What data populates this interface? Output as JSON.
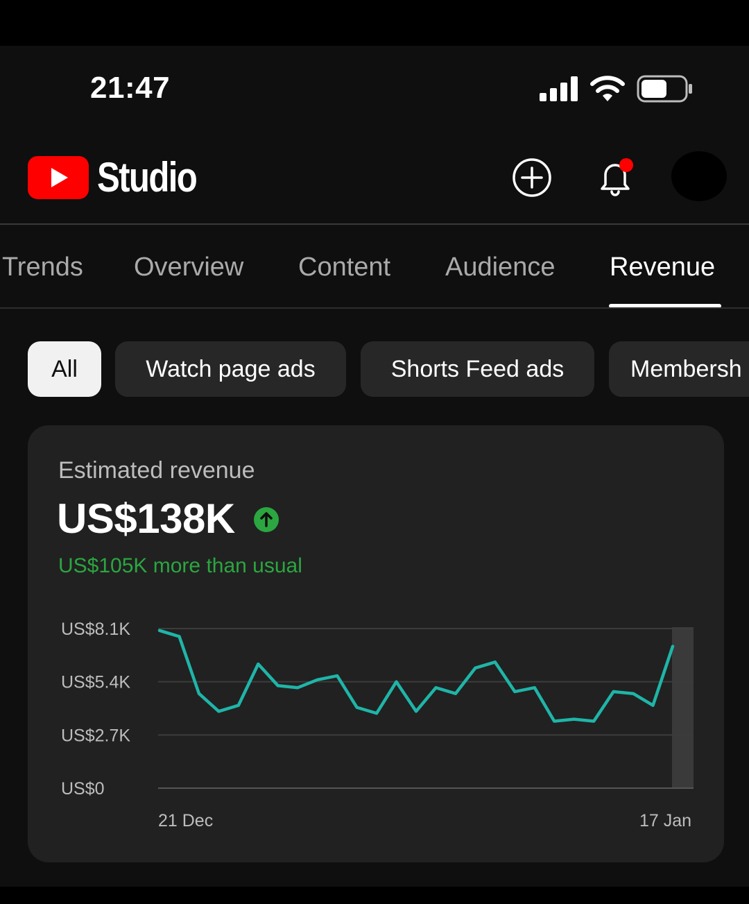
{
  "status_bar": {
    "time": "21:47",
    "icons": [
      "cellular-signal-icon",
      "wifi-icon",
      "battery-icon"
    ]
  },
  "header": {
    "brand": "Studio",
    "logo_icon": "youtube-play-icon",
    "actions": [
      "create-plus-icon",
      "notification-bell-icon",
      "account-avatar"
    ],
    "notification_dot_color": "#ff0000"
  },
  "tabs": [
    {
      "label": "Trends",
      "active": false
    },
    {
      "label": "Overview",
      "active": false
    },
    {
      "label": "Content",
      "active": false
    },
    {
      "label": "Audience",
      "active": false
    },
    {
      "label": "Revenue",
      "active": true
    }
  ],
  "chips": [
    {
      "label": "All",
      "selected": true
    },
    {
      "label": "Watch page ads",
      "selected": false
    },
    {
      "label": "Shorts Feed ads",
      "selected": false
    },
    {
      "label": "Membersh",
      "selected": false
    }
  ],
  "revenue_card": {
    "label": "Estimated revenue",
    "value": "US$138K",
    "trend_icon": "arrow-up-circle-icon",
    "delta": "US$105K more than usual"
  },
  "colors": {
    "background": "#0f0f0f",
    "card": "#212121",
    "accent_line": "#1fb5a8",
    "positive": "#2ba640",
    "youtube_red": "#ff0000"
  },
  "chart_data": {
    "type": "line",
    "title": "",
    "y_ticks": [
      "US$8.1K",
      "US$5.4K",
      "US$2.7K",
      "US$0"
    ],
    "y_tick_values": [
      8100,
      5400,
      2700,
      0
    ],
    "ylim": [
      0,
      8100
    ],
    "x_tick_labels": [
      "21 Dec",
      "17 Jan"
    ],
    "x": [
      "21 Dec",
      "22 Dec",
      "23 Dec",
      "24 Dec",
      "25 Dec",
      "26 Dec",
      "27 Dec",
      "28 Dec",
      "29 Dec",
      "30 Dec",
      "31 Dec",
      "1 Jan",
      "2 Jan",
      "3 Jan",
      "4 Jan",
      "5 Jan",
      "6 Jan",
      "7 Jan",
      "8 Jan",
      "9 Jan",
      "10 Jan",
      "11 Jan",
      "12 Jan",
      "13 Jan",
      "14 Jan",
      "15 Jan",
      "16 Jan",
      "17 Jan"
    ],
    "series": [
      {
        "values": [
          8000,
          7700,
          4800,
          3900,
          4200,
          6300,
          5200,
          5100,
          5500,
          5700,
          4100,
          3800,
          5400,
          3900,
          5100,
          4800,
          6100,
          6400,
          4900,
          5100,
          3400,
          3500,
          3400,
          4900,
          4800,
          4200,
          7200
        ]
      }
    ],
    "highlighted_point": "17 Jan",
    "grid": true
  }
}
